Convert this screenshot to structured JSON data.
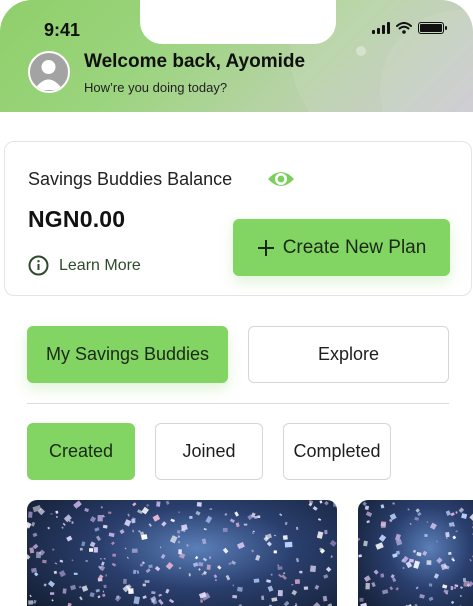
{
  "status_bar": {
    "time": "9:41"
  },
  "header": {
    "welcome": "Welcome back, Ayomide",
    "subtitle": "How’re you doing today?"
  },
  "balance": {
    "label": "Savings Buddies Balance",
    "amount": "NGN0.00",
    "learn_more": "Learn More",
    "create_button": "Create New Plan"
  },
  "tabs": {
    "my_savings": "My Savings Buddies",
    "explore": "Explore",
    "active": "My Savings Buddies"
  },
  "filters": {
    "created": "Created",
    "joined": "Joined",
    "completed": "Completed",
    "active": "Created"
  },
  "icons": {
    "eye": "eye-icon",
    "info": "info-icon",
    "plus": "plus-icon",
    "avatar": "user-avatar-icon",
    "signal": "signal-icon",
    "wifi": "wifi-icon",
    "battery": "battery-icon"
  },
  "colors": {
    "accent": "#82d463",
    "eye": "#7bcf5c",
    "text_dark": "#1e1e1e"
  }
}
